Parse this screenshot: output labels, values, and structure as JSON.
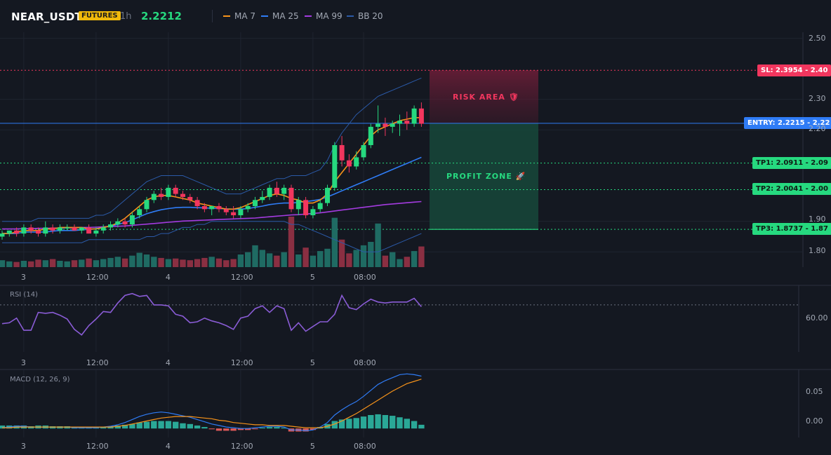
{
  "header": {
    "symbol": "NEAR_USDT",
    "market_badge": "FUTURES",
    "timeframe": "1h",
    "last_price": "2.2212",
    "indicators": [
      {
        "label": "MA 7",
        "color": "#f7931a"
      },
      {
        "label": "MA 25",
        "color": "#2f7cf6"
      },
      {
        "label": "MA 99",
        "color": "#a43be0"
      },
      {
        "label": "BB 20",
        "color": "#2b5aa8"
      }
    ]
  },
  "colors": {
    "up": "#26d97f",
    "down": "#f2365e",
    "vol_up": "#1f6b63",
    "vol_down": "#8a2f42",
    "background": "#141821",
    "grid": "#1f2430",
    "entry": "#2f7cf6",
    "stop": "#f2365e",
    "target": "#26d97f"
  },
  "price_axis": {
    "min": 1.75,
    "max": 2.52,
    "ticks": [
      "2.50",
      "2.30",
      "2.20",
      "1.90",
      "1.80"
    ],
    "tick_values": [
      2.5,
      2.3,
      2.2,
      1.9,
      1.8
    ]
  },
  "time_axis": {
    "labels": [
      "3",
      "12:00",
      "4",
      "12:00",
      "5",
      "08:00"
    ],
    "label_index": [
      3,
      13,
      23,
      33,
      43,
      50
    ]
  },
  "levels": {
    "stop_loss": {
      "label": "SL: 2.3954 - 2.40",
      "value": 2.3954
    },
    "entry": {
      "label": "ENTRY: 2.2215 - 2.22",
      "value": 2.2215
    },
    "targets": [
      {
        "label": "TP1: 2.0911 - 2.09",
        "value": 2.0911
      },
      {
        "label": "TP2: 2.0041 - 2.00",
        "value": 2.0041
      },
      {
        "label": "TP3: 1.8737 - 1.87",
        "value": 1.8737
      }
    ]
  },
  "zones": {
    "risk": "RISK AREA 🛡",
    "profit": "PROFIT ZONE 🚀"
  },
  "chart_data": {
    "type": "candlestick",
    "candles": [
      [
        1.85,
        1.87,
        1.84,
        1.86
      ],
      [
        1.86,
        1.87,
        1.85,
        1.87
      ],
      [
        1.87,
        1.88,
        1.85,
        1.86
      ],
      [
        1.86,
        1.89,
        1.85,
        1.88
      ],
      [
        1.88,
        1.89,
        1.86,
        1.87
      ],
      [
        1.87,
        1.88,
        1.85,
        1.86
      ],
      [
        1.86,
        1.9,
        1.85,
        1.88
      ],
      [
        1.88,
        1.89,
        1.86,
        1.87
      ],
      [
        1.87,
        1.89,
        1.86,
        1.88
      ],
      [
        1.88,
        1.89,
        1.87,
        1.88
      ],
      [
        1.88,
        1.89,
        1.87,
        1.87
      ],
      [
        1.87,
        1.88,
        1.86,
        1.88
      ],
      [
        1.88,
        1.89,
        1.86,
        1.86
      ],
      [
        1.86,
        1.88,
        1.85,
        1.87
      ],
      [
        1.87,
        1.89,
        1.86,
        1.88
      ],
      [
        1.88,
        1.9,
        1.87,
        1.89
      ],
      [
        1.89,
        1.91,
        1.88,
        1.9
      ],
      [
        1.9,
        1.91,
        1.88,
        1.89
      ],
      [
        1.89,
        1.93,
        1.88,
        1.92
      ],
      [
        1.92,
        1.95,
        1.91,
        1.94
      ],
      [
        1.94,
        1.98,
        1.93,
        1.97
      ],
      [
        1.97,
        2.0,
        1.96,
        1.99
      ],
      [
        1.99,
        2.01,
        1.97,
        1.98
      ],
      [
        1.98,
        2.02,
        1.97,
        2.01
      ],
      [
        2.01,
        2.02,
        1.98,
        1.99
      ],
      [
        1.99,
        2.0,
        1.97,
        1.98
      ],
      [
        1.98,
        1.99,
        1.96,
        1.97
      ],
      [
        1.97,
        1.98,
        1.94,
        1.95
      ],
      [
        1.95,
        1.96,
        1.93,
        1.94
      ],
      [
        1.94,
        1.95,
        1.92,
        1.95
      ],
      [
        1.95,
        1.96,
        1.93,
        1.94
      ],
      [
        1.94,
        1.95,
        1.92,
        1.93
      ],
      [
        1.93,
        1.95,
        1.91,
        1.92
      ],
      [
        1.92,
        1.95,
        1.91,
        1.94
      ],
      [
        1.94,
        1.96,
        1.93,
        1.95
      ],
      [
        1.95,
        1.98,
        1.94,
        1.97
      ],
      [
        1.97,
        2.0,
        1.96,
        1.98
      ],
      [
        1.98,
        2.02,
        1.97,
        2.01
      ],
      [
        2.01,
        2.03,
        1.98,
        1.99
      ],
      [
        1.99,
        2.02,
        1.97,
        2.01
      ],
      [
        2.01,
        2.02,
        1.93,
        1.94
      ],
      [
        1.94,
        1.98,
        1.92,
        1.97
      ],
      [
        1.97,
        1.98,
        1.91,
        1.92
      ],
      [
        1.92,
        1.95,
        1.91,
        1.94
      ],
      [
        1.94,
        1.97,
        1.93,
        1.96
      ],
      [
        1.96,
        2.02,
        1.95,
        2.01
      ],
      [
        2.01,
        2.16,
        2.0,
        2.15
      ],
      [
        2.15,
        2.18,
        2.08,
        2.1
      ],
      [
        2.1,
        2.12,
        2.06,
        2.08
      ],
      [
        2.08,
        2.13,
        2.07,
        2.11
      ],
      [
        2.11,
        2.16,
        2.1,
        2.15
      ],
      [
        2.15,
        2.22,
        2.14,
        2.21
      ],
      [
        2.21,
        2.28,
        2.19,
        2.22
      ],
      [
        2.22,
        2.24,
        2.18,
        2.21
      ],
      [
        2.21,
        2.23,
        2.19,
        2.22
      ],
      [
        2.22,
        2.25,
        2.18,
        2.23
      ],
      [
        2.23,
        2.26,
        2.2,
        2.22
      ],
      [
        2.22,
        2.28,
        2.21,
        2.27
      ],
      [
        2.27,
        2.29,
        2.21,
        2.22
      ]
    ],
    "volume": [
      12,
      10,
      9,
      11,
      10,
      13,
      12,
      14,
      11,
      10,
      12,
      13,
      15,
      12,
      14,
      16,
      18,
      15,
      20,
      25,
      22,
      18,
      16,
      14,
      15,
      13,
      12,
      14,
      16,
      18,
      15,
      12,
      14,
      22,
      26,
      38,
      30,
      24,
      20,
      26,
      88,
      22,
      34,
      20,
      28,
      32,
      86,
      48,
      24,
      30,
      38,
      44,
      76,
      20,
      26,
      14,
      18,
      28,
      36
    ],
    "ma7": [
      1.86,
      1.86,
      1.865,
      1.87,
      1.87,
      1.87,
      1.875,
      1.875,
      1.88,
      1.88,
      1.88,
      1.88,
      1.875,
      1.875,
      1.88,
      1.885,
      1.895,
      1.91,
      1.93,
      1.95,
      1.97,
      1.98,
      1.985,
      1.985,
      1.98,
      1.975,
      1.97,
      1.96,
      1.955,
      1.95,
      1.945,
      1.94,
      1.94,
      1.945,
      1.955,
      1.965,
      1.975,
      1.985,
      1.99,
      1.985,
      1.975,
      1.97,
      1.96,
      1.96,
      1.97,
      1.99,
      2.03,
      2.06,
      2.09,
      2.12,
      2.15,
      2.18,
      2.2,
      2.21,
      2.22,
      2.23,
      2.235,
      2.24,
      2.24
    ],
    "ma25": [
      1.86,
      1.86,
      1.86,
      1.865,
      1.865,
      1.865,
      1.865,
      1.868,
      1.87,
      1.87,
      1.87,
      1.872,
      1.874,
      1.876,
      1.88,
      1.885,
      1.89,
      1.896,
      1.905,
      1.915,
      1.925,
      1.932,
      1.938,
      1.942,
      1.945,
      1.946,
      1.946,
      1.945,
      1.944,
      1.943,
      1.942,
      1.941,
      1.94,
      1.94,
      1.942,
      1.946,
      1.95,
      1.955,
      1.958,
      1.96,
      1.96,
      1.962,
      1.965,
      1.968,
      1.972,
      1.98,
      1.99,
      2.0,
      2.01,
      2.02,
      2.03,
      2.04,
      2.05,
      2.06,
      2.07,
      2.08,
      2.09,
      2.1,
      2.11
    ],
    "ma99": [
      1.875,
      1.875,
      1.875,
      1.876,
      1.876,
      1.877,
      1.877,
      1.878,
      1.878,
      1.879,
      1.879,
      1.88,
      1.88,
      1.881,
      1.882,
      1.883,
      1.884,
      1.885,
      1.887,
      1.889,
      1.891,
      1.893,
      1.895,
      1.897,
      1.899,
      1.901,
      1.902,
      1.903,
      1.904,
      1.905,
      1.906,
      1.907,
      1.908,
      1.909,
      1.91,
      1.911,
      1.913,
      1.915,
      1.917,
      1.919,
      1.921,
      1.922,
      1.924,
      1.926,
      1.928,
      1.931,
      1.934,
      1.937,
      1.94,
      1.943,
      1.946,
      1.949,
      1.952,
      1.955,
      1.957,
      1.959,
      1.961,
      1.963,
      1.965
    ],
    "bb_upper": [
      1.9,
      1.9,
      1.9,
      1.9,
      1.9,
      1.91,
      1.91,
      1.91,
      1.91,
      1.91,
      1.91,
      1.91,
      1.91,
      1.92,
      1.92,
      1.93,
      1.95,
      1.97,
      1.99,
      2.01,
      2.03,
      2.04,
      2.05,
      2.05,
      2.05,
      2.05,
      2.04,
      2.03,
      2.02,
      2.01,
      2.0,
      1.99,
      1.99,
      1.99,
      2.0,
      2.01,
      2.02,
      2.03,
      2.04,
      2.04,
      2.05,
      2.05,
      2.05,
      2.06,
      2.07,
      2.1,
      2.15,
      2.19,
      2.22,
      2.25,
      2.27,
      2.29,
      2.31,
      2.32,
      2.33,
      2.34,
      2.35,
      2.36,
      2.37
    ],
    "bb_lower": [
      1.83,
      1.83,
      1.83,
      1.83,
      1.83,
      1.83,
      1.83,
      1.83,
      1.83,
      1.83,
      1.83,
      1.83,
      1.84,
      1.84,
      1.84,
      1.84,
      1.84,
      1.84,
      1.84,
      1.84,
      1.85,
      1.85,
      1.86,
      1.86,
      1.87,
      1.88,
      1.88,
      1.89,
      1.89,
      1.9,
      1.9,
      1.9,
      1.9,
      1.9,
      1.9,
      1.9,
      1.9,
      1.9,
      1.9,
      1.9,
      1.89,
      1.89,
      1.88,
      1.87,
      1.86,
      1.85,
      1.84,
      1.83,
      1.82,
      1.81,
      1.8,
      1.8,
      1.8,
      1.81,
      1.82,
      1.83,
      1.84,
      1.85,
      1.86
    ],
    "rsi": {
      "title": "RSI (14)",
      "ticks": [
        "60.00"
      ],
      "tick_values": [
        60
      ],
      "min": 20,
      "max": 90,
      "overbought": 70,
      "values": [
        50,
        51,
        56,
        43,
        43,
        62,
        61,
        62,
        59,
        55,
        44,
        38,
        48,
        55,
        63,
        62,
        72,
        80,
        82,
        79,
        80,
        70,
        70,
        69,
        60,
        58,
        51,
        52,
        56,
        53,
        51,
        48,
        44,
        56,
        58,
        66,
        69,
        62,
        69,
        66,
        43,
        51,
        42,
        47,
        52,
        52,
        60,
        80,
        67,
        65,
        71,
        76,
        73,
        72,
        73,
        73,
        73,
        77,
        68
      ]
    },
    "macd": {
      "title": "MACD (12, 26, 9)",
      "ticks": [
        "0.05",
        "0.00"
      ],
      "tick_values": [
        0.05,
        0
      ],
      "min": -0.012,
      "max": 0.078,
      "macd": [
        0.001,
        0.002,
        0.003,
        0.003,
        0.002,
        0.002,
        0.002,
        0.002,
        0.002,
        0.002,
        0.001,
        0.001,
        0.001,
        0.001,
        0.002,
        0.003,
        0.005,
        0.008,
        0.012,
        0.016,
        0.019,
        0.021,
        0.022,
        0.021,
        0.019,
        0.017,
        0.015,
        0.012,
        0.009,
        0.006,
        0.004,
        0.002,
        0.001,
        0.0,
        0.0,
        0.001,
        0.002,
        0.003,
        0.003,
        0.002,
        -0.002,
        -0.002,
        -0.003,
        -0.002,
        0.002,
        0.008,
        0.018,
        0.025,
        0.031,
        0.036,
        0.043,
        0.051,
        0.059,
        0.064,
        0.068,
        0.072,
        0.073,
        0.072,
        0.07
      ],
      "signal": [
        0.001,
        0.001,
        0.002,
        0.002,
        0.002,
        0.002,
        0.002,
        0.002,
        0.002,
        0.002,
        0.002,
        0.002,
        0.002,
        0.002,
        0.002,
        0.002,
        0.003,
        0.004,
        0.006,
        0.008,
        0.01,
        0.012,
        0.014,
        0.015,
        0.016,
        0.016,
        0.016,
        0.015,
        0.014,
        0.013,
        0.011,
        0.01,
        0.008,
        0.007,
        0.006,
        0.005,
        0.005,
        0.004,
        0.004,
        0.004,
        0.003,
        0.002,
        0.001,
        0.001,
        0.001,
        0.003,
        0.006,
        0.01,
        0.015,
        0.02,
        0.026,
        0.032,
        0.038,
        0.044,
        0.05,
        0.055,
        0.06,
        0.063,
        0.066
      ],
      "hist": [
        0.004,
        0.004,
        0.004,
        0.004,
        0.003,
        0.004,
        0.004,
        0.003,
        0.003,
        0.003,
        0.002,
        0.002,
        0.002,
        0.002,
        0.002,
        0.003,
        0.004,
        0.005,
        0.006,
        0.008,
        0.009,
        0.01,
        0.01,
        0.01,
        0.009,
        0.007,
        0.006,
        0.004,
        0.002,
        -0.001,
        -0.003,
        -0.003,
        -0.003,
        -0.002,
        -0.002,
        -0.001,
        0.001,
        0.002,
        0.002,
        0.001,
        -0.004,
        -0.004,
        -0.004,
        -0.002,
        0.002,
        0.006,
        0.01,
        0.012,
        0.013,
        0.014,
        0.016,
        0.018,
        0.019,
        0.018,
        0.017,
        0.015,
        0.013,
        0.01,
        0.005
      ]
    }
  }
}
